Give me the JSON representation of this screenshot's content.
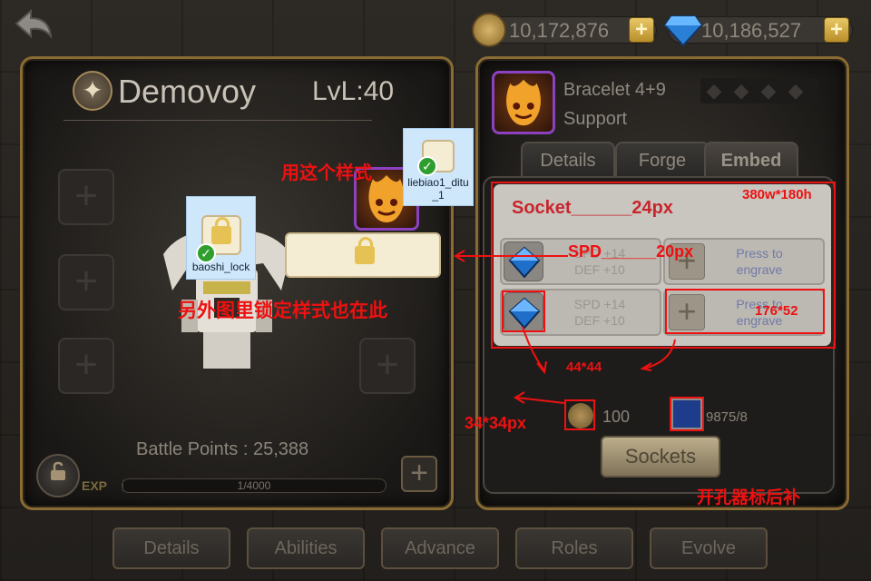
{
  "currency": {
    "gold_amount": "10,172,876",
    "gem_amount": "10,186,527"
  },
  "hero": {
    "name": "Demovoy",
    "level": "LvL:40",
    "battle_points": "Battle Points : 25,388",
    "exp_label": "EXP",
    "exp_text": "1/4000",
    "exp_progress": 0.0003
  },
  "item": {
    "name": "Bracelet 4+9",
    "role": "Support",
    "tabs": [
      "Details",
      "Forge",
      "Embed"
    ],
    "active_tab": "Embed"
  },
  "socket": {
    "title": "Socket",
    "rows": [
      {
        "stat1": "SPD +14",
        "stat2": "DEF +10",
        "engrave1": "Press to",
        "engrave2": "engrave"
      },
      {
        "stat1": "SPD +14",
        "stat2": "DEF +10",
        "engrave1": "Press to",
        "engrave2": "engrave"
      }
    ],
    "cost": "100",
    "tool_count": "9875/8",
    "sockets_button": "Sockets"
  },
  "bottom_tabs": [
    "Details",
    "Abilities",
    "Advance",
    "Roles",
    "Evolve"
  ],
  "annotations": {
    "use_this_style": "用这个样式",
    "other_lock_style": "另外图里锁定样式也在此",
    "socket_size": "Socket______24px",
    "spd_size": "SPD______20px",
    "panel_size": "380w*180h",
    "engrave_size": "176*52",
    "gem_size": "44*44",
    "coin_size": "34*34px",
    "opener_note": "开孔器标后补",
    "asset_lock": "baoshi_lock",
    "asset_list": "liebiao1_ditu_1"
  },
  "colors": {
    "annotation_red": "#ee1111",
    "panel_border_gold": "#8a6b33",
    "item_purple": "#8c42c0"
  }
}
